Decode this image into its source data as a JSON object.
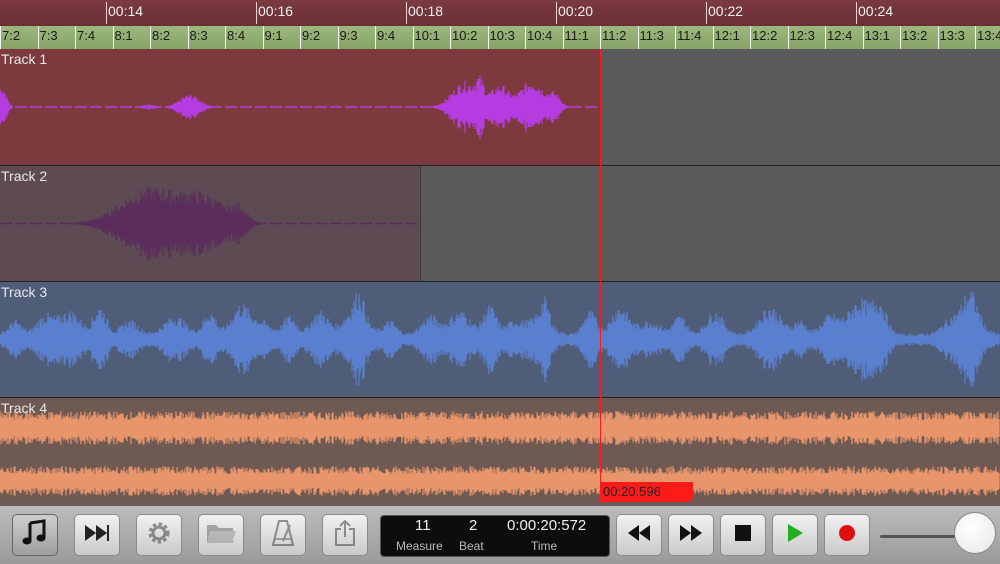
{
  "timeline": {
    "time_labels": [
      "00:14",
      "00:16",
      "00:18",
      "00:20",
      "00:22",
      "00:24"
    ],
    "measure_labels": [
      "7:2",
      "7:3",
      "7:4",
      "8:1",
      "8:2",
      "8:3",
      "8:4",
      "9:1",
      "9:2",
      "9:3",
      "9:4",
      "10:1",
      "10:2",
      "10:3",
      "10:4",
      "11:1",
      "11:2",
      "11:3",
      "11:4",
      "12:1",
      "12:2",
      "12:3",
      "12:4",
      "13:1",
      "13:2",
      "13:3",
      "13:4"
    ]
  },
  "tracks": [
    {
      "label": "Track 1",
      "region_color": "#7c3a3f",
      "wave_color": "#b53ce0"
    },
    {
      "label": "Track 2",
      "region_color": "#5e4a52",
      "wave_color": "#5a2d5c"
    },
    {
      "label": "Track 3",
      "region_color": "#4f5d78",
      "wave_color": "#5b7fcf"
    },
    {
      "label": "Track 4",
      "region_color": "#6e5a52",
      "wave_color": "#e8956c"
    }
  ],
  "playhead": {
    "time": "00:20.596",
    "color": "#ff1a1a"
  },
  "toolbar": {
    "buttons": [
      "music-note-icon",
      "fast-forward-icon",
      "gear-icon",
      "folder-icon",
      "metronome-icon",
      "share-icon"
    ],
    "counter": {
      "measure": "11",
      "beat": "2",
      "time": "0:00:20:572",
      "measure_label": "Measure",
      "beat_label": "Beat",
      "time_label": "Time"
    },
    "transport": [
      "rewind-icon",
      "forward-icon",
      "stop-icon",
      "play-icon",
      "record-icon"
    ],
    "play_color": "#20b020",
    "record_color": "#e01010"
  }
}
